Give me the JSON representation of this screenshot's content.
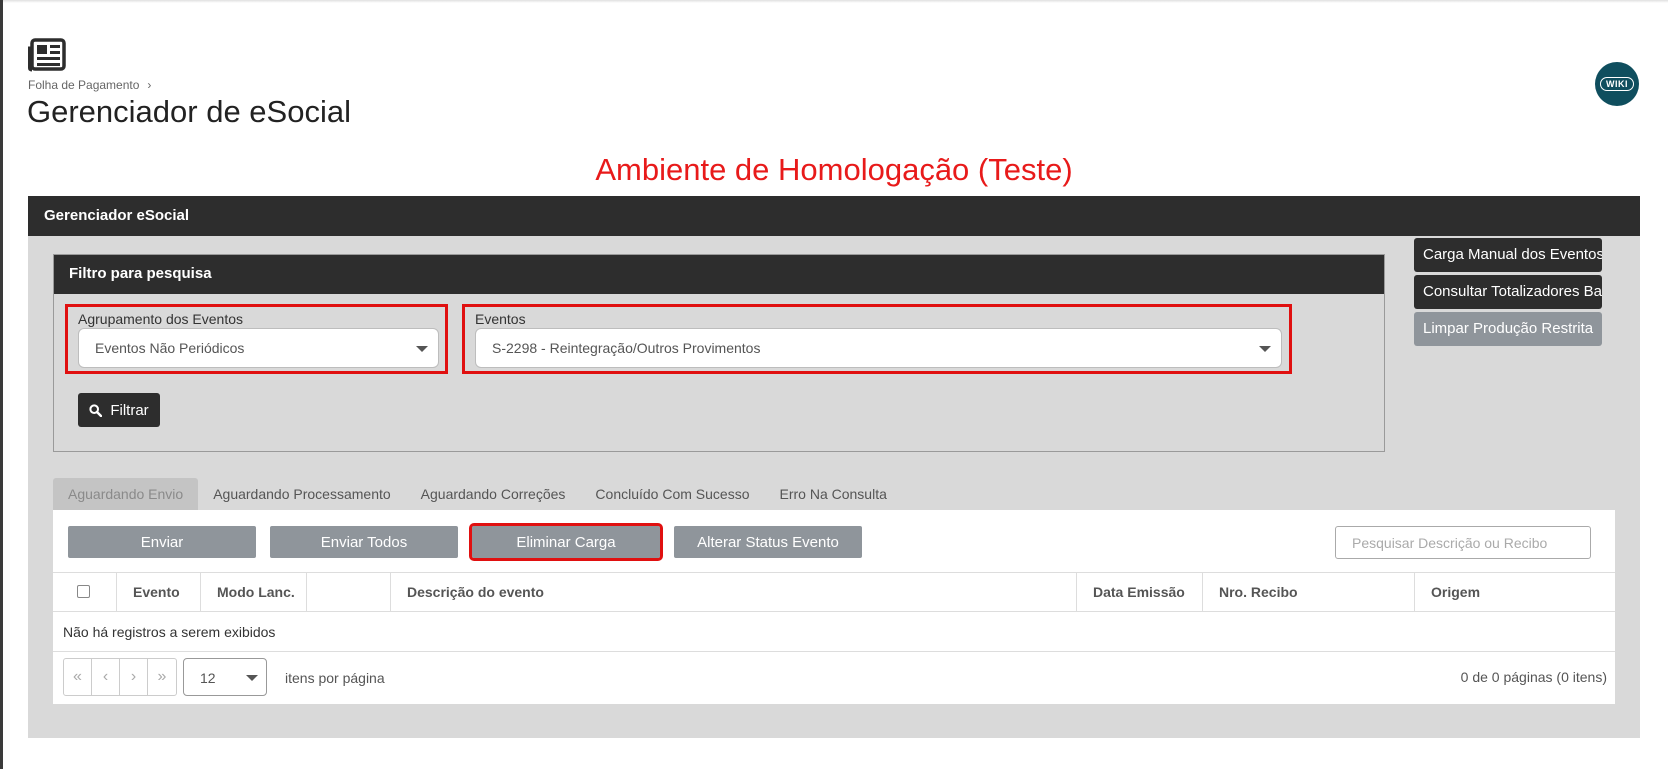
{
  "header": {
    "breadcrumb": "Folha de Pagamento",
    "title": "Gerenciador de eSocial",
    "wiki_label": "WIKI"
  },
  "environment_banner": "Ambiente de Homologação (Teste)",
  "panel": {
    "title": "Gerenciador eSocial",
    "filter": {
      "title": "Filtro para pesquisa",
      "grouping_label": "Agrupamento dos Eventos",
      "grouping_value": "Eventos Não Periódicos",
      "events_label": "Eventos",
      "events_value": "S-2298 - Reintegração/Outros Provimentos",
      "filter_button": "Filtrar"
    },
    "side_buttons": [
      {
        "label": "Carga Manual dos Eventos"
      },
      {
        "label": "Consultar Totalizadores Base"
      },
      {
        "label": "Limpar Produção Restrita"
      }
    ],
    "tabs": [
      {
        "label": "Aguardando Envio"
      },
      {
        "label": "Aguardando Processamento"
      },
      {
        "label": "Aguardando Correções"
      },
      {
        "label": "Concluído Com Sucesso"
      },
      {
        "label": "Erro Na Consulta"
      }
    ],
    "actions": {
      "send": "Enviar",
      "send_all": "Enviar Todos",
      "delete_load": "Eliminar Carga",
      "change_status": "Alterar Status Evento"
    },
    "search_placeholder": "Pesquisar Descrição ou Recibo",
    "table": {
      "columns": [
        "Evento",
        "Modo Lanc.",
        "",
        "Descrição do evento",
        "Data Emissão",
        "Nro. Recibo",
        "Origem"
      ],
      "empty_message": "Não há registros a serem exibidos"
    },
    "pagination": {
      "first": "«",
      "prev": "‹",
      "next": "›",
      "last": "»",
      "per_page": "12",
      "per_page_label": "itens por página",
      "info": "0 de 0 páginas (0 itens)"
    }
  }
}
